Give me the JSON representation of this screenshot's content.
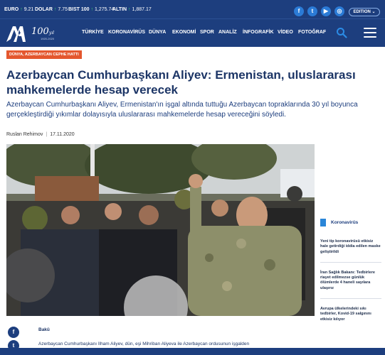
{
  "ticker": {
    "items": [
      {
        "label": "EURO",
        "value": "9.21"
      },
      {
        "label": "DOLAR",
        "value": "7.75"
      },
      {
        "label": "BIST 100",
        "value": "1,275.74"
      },
      {
        "label": "ALTIN",
        "value": "1,887.17"
      }
    ],
    "social": [
      "f",
      "t",
      "▶",
      "◎"
    ],
    "edition": "EDITION ⌄"
  },
  "nav": {
    "logo_100": "100",
    "logo_suffix": "yıl",
    "logo_years": "1920-2020",
    "items": [
      "TÜRKİYE",
      "KORONAVİRÜS",
      "DÜNYA",
      "EKONOMİ",
      "SPOR",
      "ANALİZ",
      "İNFOGRAFİK",
      "VİDEO",
      "FOTOĞRAF"
    ]
  },
  "article": {
    "category": "DÜNYA, AZERBAYCAN CEPHE HATTI",
    "title": "Azerbaycan Cumhurbaşkanı Aliyev: Ermenistan, uluslararası mahkemelerde hesap verecek",
    "summary": "Azerbaycan Cumhurbaşkanı Aliyev, Ermenistan'ın işgal altında tuttuğu Azerbaycan topraklarında 30 yıl boyunca gerçekleştirdiği yıkımlar dolayısıyla uluslararası mahkemelerde hesap vereceğini söyledi.",
    "author": "Ruslan Rehimov",
    "date": "17.11.2020",
    "dateline": "Bakü",
    "body_start": "Azerbaycan Cumhurbaşkanı İlham Aliyev, dün, eşi Mihriban Aliyeva ile Azerbaycan ordusunun işgalden"
  },
  "sidebar": {
    "category": "Koronavirüs",
    "items": [
      "Yeni tip koronavirüsü etkisiz hale getirdiği iddia edilen maske geliştirildi",
      "İran Sağlık Bakanı: Tedbirlere riayet edilmezse günlük ölümlerde 4 haneli sayılara ulaşırız",
      "Avrupa ülkelerindeki sıkı tedbirler, Kovid-19 salgınını etkisiz kılıyor"
    ]
  },
  "colors": {
    "brand": "#1d3e7e",
    "accent": "#e4572e",
    "up": "#38d36a",
    "social": "#2b7bd6"
  }
}
